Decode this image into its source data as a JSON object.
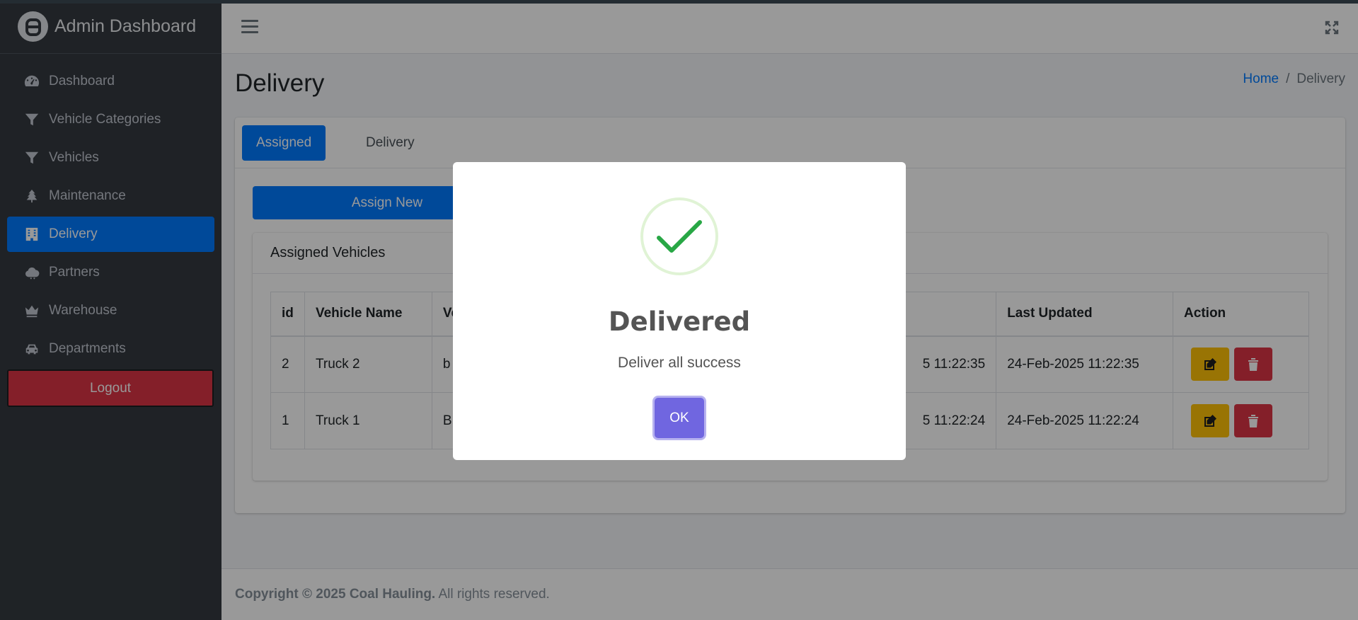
{
  "brand": {
    "title": "Admin Dashboard"
  },
  "sidebar": {
    "items": [
      {
        "label": "Dashboard",
        "icon": "gauge-icon"
      },
      {
        "label": "Vehicle Categories",
        "icon": "filter-icon"
      },
      {
        "label": "Vehicles",
        "icon": "filter-icon"
      },
      {
        "label": "Maintenance",
        "icon": "tree-icon"
      },
      {
        "label": "Delivery",
        "icon": "building-icon",
        "active": true
      },
      {
        "label": "Partners",
        "icon": "cloud-icon"
      },
      {
        "label": "Warehouse",
        "icon": "crown-icon"
      },
      {
        "label": "Departments",
        "icon": "car-icon"
      }
    ],
    "logout_label": "Logout"
  },
  "header": {
    "menu_icon": "hamburger-icon",
    "expand_icon": "expand-icon"
  },
  "page": {
    "title": "Delivery",
    "breadcrumb": {
      "home": "Home",
      "separator": "/",
      "current": "Delivery"
    }
  },
  "tabs": [
    {
      "label": "Assigned",
      "active": true
    },
    {
      "label": "Delivery",
      "active": false
    }
  ],
  "assign_button_label": "Assign New",
  "assigned_card": {
    "title": "Assigned Vehicles",
    "columns": [
      "id",
      "Vehicle Name",
      "Ve",
      "",
      "Last Updated",
      "Action"
    ],
    "rows": [
      {
        "id": "2",
        "vehicle_name": "Truck 2",
        "col3": "b",
        "col4": "5 11:22:35",
        "last_updated": "24-Feb-2025 11:22:35"
      },
      {
        "id": "1",
        "vehicle_name": "Truck 1",
        "col3": "B",
        "col4": "5 11:22:24",
        "last_updated": "24-Feb-2025 11:22:24"
      }
    ]
  },
  "footer": {
    "copyright": "Copyright © 2025 Coal Hauling.",
    "rights": " All rights reserved."
  },
  "modal": {
    "title": "Delivered",
    "text": "Deliver all success",
    "ok_label": "OK",
    "icon": "success-check-icon"
  },
  "colors": {
    "sidebar_bg": "#343a40",
    "primary": "#007bff",
    "danger": "#dc3545",
    "warning": "#ffc107",
    "modal_ok": "#7066e0",
    "success_check": "#28a745"
  }
}
